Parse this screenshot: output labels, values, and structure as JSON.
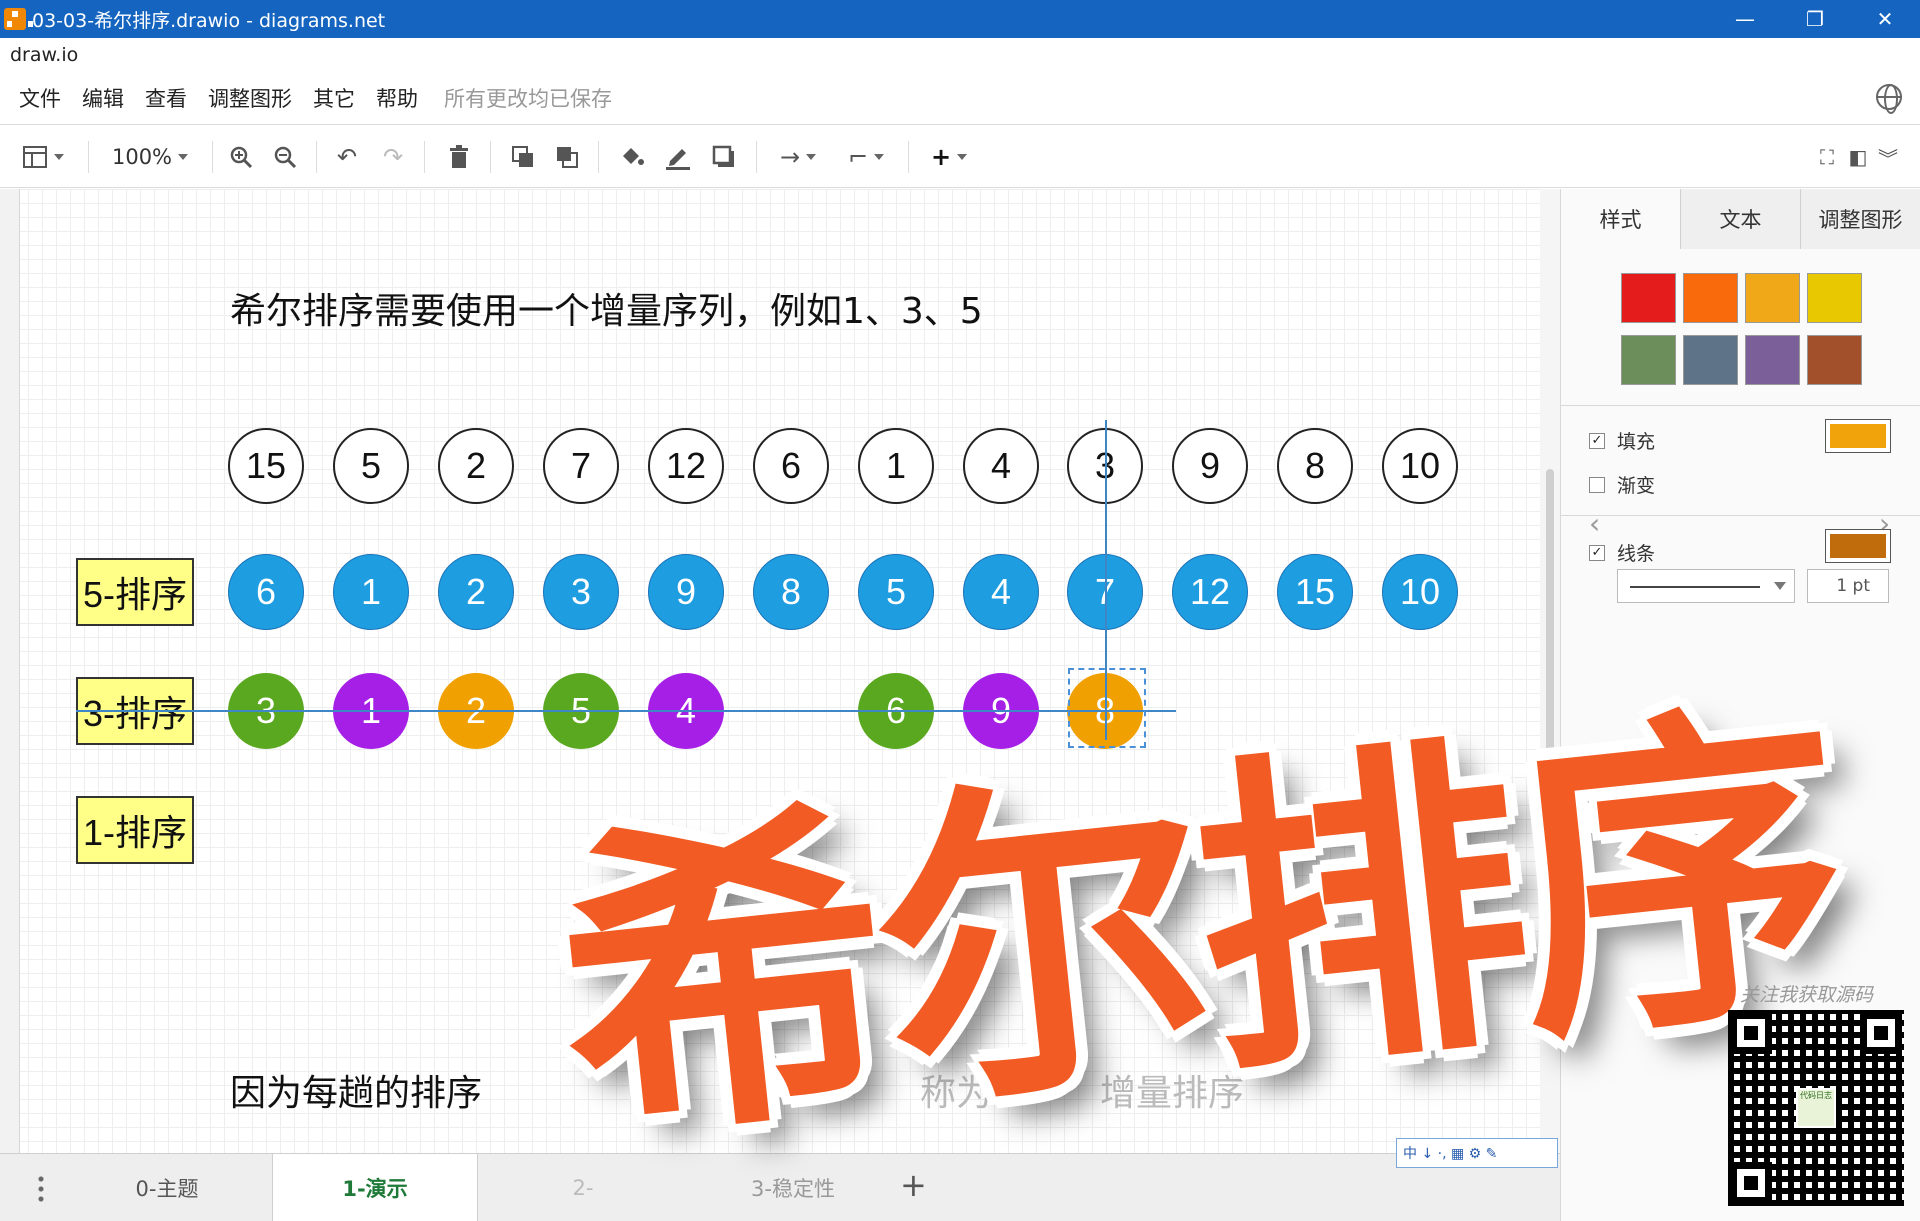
{
  "window": {
    "title": "03-03-希尔排序.drawio - diagrams.net"
  },
  "app": {
    "name": "draw.io"
  },
  "menu": {
    "items": [
      "文件",
      "编辑",
      "查看",
      "调整图形",
      "其它",
      "帮助"
    ],
    "status": "所有更改均已保存"
  },
  "toolbar": {
    "zoom": "100%"
  },
  "canvas": {
    "heading": "希尔排序需要使用一个增量序列，例如1、3、5",
    "footer_text_left": "因为每趟的排序",
    "footer_text_mid": "称为",
    "footer_text_right": "增量排序",
    "row0": [
      "15",
      "5",
      "2",
      "7",
      "12",
      "6",
      "1",
      "4",
      "3",
      "9",
      "8",
      "10"
    ],
    "row1_label": "5-排序",
    "row1": [
      "6",
      "1",
      "2",
      "3",
      "9",
      "8",
      "5",
      "4",
      "7",
      "12",
      "15",
      "10"
    ],
    "row2_label": "3-排序",
    "row2": [
      "3",
      "1",
      "2",
      "5",
      "4",
      "6",
      "9",
      "8"
    ],
    "row3_label": "1-排序"
  },
  "colors": {
    "blue": "#1e9de0",
    "green": "#5aa820",
    "purple": "#a51fe6",
    "orange": "#f0a000",
    "label_fill": "#ffff88",
    "overlay": "#f25b23"
  },
  "panel": {
    "tabs": [
      "样式",
      "文本",
      "调整图形"
    ],
    "swatches": [
      "#e51c1c",
      "#f86a0c",
      "#f0a818",
      "#e8c800",
      "#6b8e5a",
      "#5f7388",
      "#7a5f99",
      "#a24f2c"
    ],
    "fill_label": "填充",
    "fill_color": "#f0a30a",
    "gradient_label": "渐变",
    "line_label": "线条",
    "line_color": "#c06c0c",
    "line_width": "1 pt"
  },
  "bottom_tabs": [
    "0-主题",
    "1-演示",
    "2-",
    "3-稳定性"
  ],
  "overlay": {
    "text": "希尔排序"
  },
  "qr": {
    "caption": "关注我获取源码",
    "logo_text": "代码日志"
  },
  "ime": {
    "text": "中 ↓ ·, ▦ ⚙ ✎"
  }
}
